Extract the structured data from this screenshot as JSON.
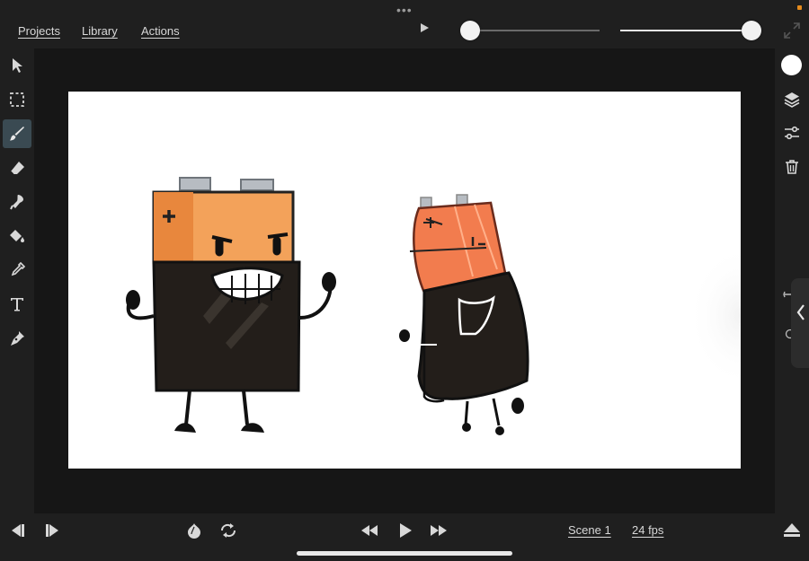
{
  "menu": {
    "projects": "Projects",
    "library": "Library",
    "actions": "Actions"
  },
  "sliders": {
    "onion_skin_value": 0.0,
    "opacity_value": 1.0
  },
  "left_tools": [
    "select-icon",
    "marquee-icon",
    "brush-icon",
    "eraser-icon",
    "smudge-icon",
    "fill-bucket-icon",
    "eyedropper-icon",
    "text-icon",
    "pen-icon"
  ],
  "right_tools": [
    "color-swatch",
    "layers-icon",
    "adjustments-icon",
    "trash-icon"
  ],
  "colors": {
    "active_tool": "#3a4a52",
    "toolbar_bg": "#1f1f1f",
    "canvas_bg": "#ffffff",
    "accent": "#e58b1d",
    "current_color": "#ffffff"
  },
  "bottom": {
    "scene": "Scene 1",
    "fps": "24 fps"
  }
}
